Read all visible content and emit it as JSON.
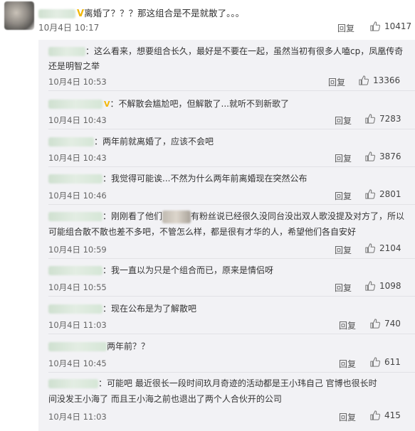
{
  "main": {
    "text": "离婚了？？？那这组合是不是就散了。。。",
    "time": "10月4日 10:17",
    "reply": "回复",
    "likes": "10417"
  },
  "subs": [
    {
      "text1": "：这么看来，想要组合长久，最好是不要在一起，虽然当初有很多人嗑cp，凤凰传奇",
      "text2": "还是明智之举",
      "time": "10月4日 10:53",
      "reply": "回复",
      "likes": "13366"
    },
    {
      "text1": "：不解散会尴尬吧，但解散了...就听不到新歌了",
      "time": "10月4日 10:43",
      "reply": "回复",
      "likes": "7283"
    },
    {
      "text1": "：两年前就离婚了，应该不会吧",
      "time": "10月4日 10:43",
      "reply": "回复",
      "likes": "3876"
    },
    {
      "text1": "：我觉得可能诶...不然为什么两年前离婚现在突然公布",
      "time": "10月4日 10:46",
      "reply": "回复",
      "likes": "2801"
    },
    {
      "text1": "：刚刚看了他们",
      "text1b": "有粉丝说已经很久没同台没出双人歌没提及对方了，所以",
      "text2": "可能组合散不散也差不多吧，不管怎么样，都是很有才华的人，希望他们各自安好",
      "time": "10月4日 10:59",
      "reply": "回复",
      "likes": "2104"
    },
    {
      "text1": "：我一直以为只是个组合而已，原来是情侣呀",
      "time": "10月4日 10:55",
      "reply": "回复",
      "likes": "1098"
    },
    {
      "text1": "：现在公布是为了解散吧",
      "time": "10月4日 11:03",
      "reply": "回复",
      "likes": "740"
    },
    {
      "text1": "两年前？？",
      "time": "10月4日 10:45",
      "reply": "回复",
      "likes": "611"
    },
    {
      "text1": "：可能吧 最近很长一段时间玖月奇迹的活动都是王小玮自己 官博也很长时",
      "text2": "间没发王小海了   而且王小海之前也退出了两个人合伙开的公司",
      "time": "10月4日 11:03",
      "reply": "回复",
      "likes": "415"
    }
  ]
}
